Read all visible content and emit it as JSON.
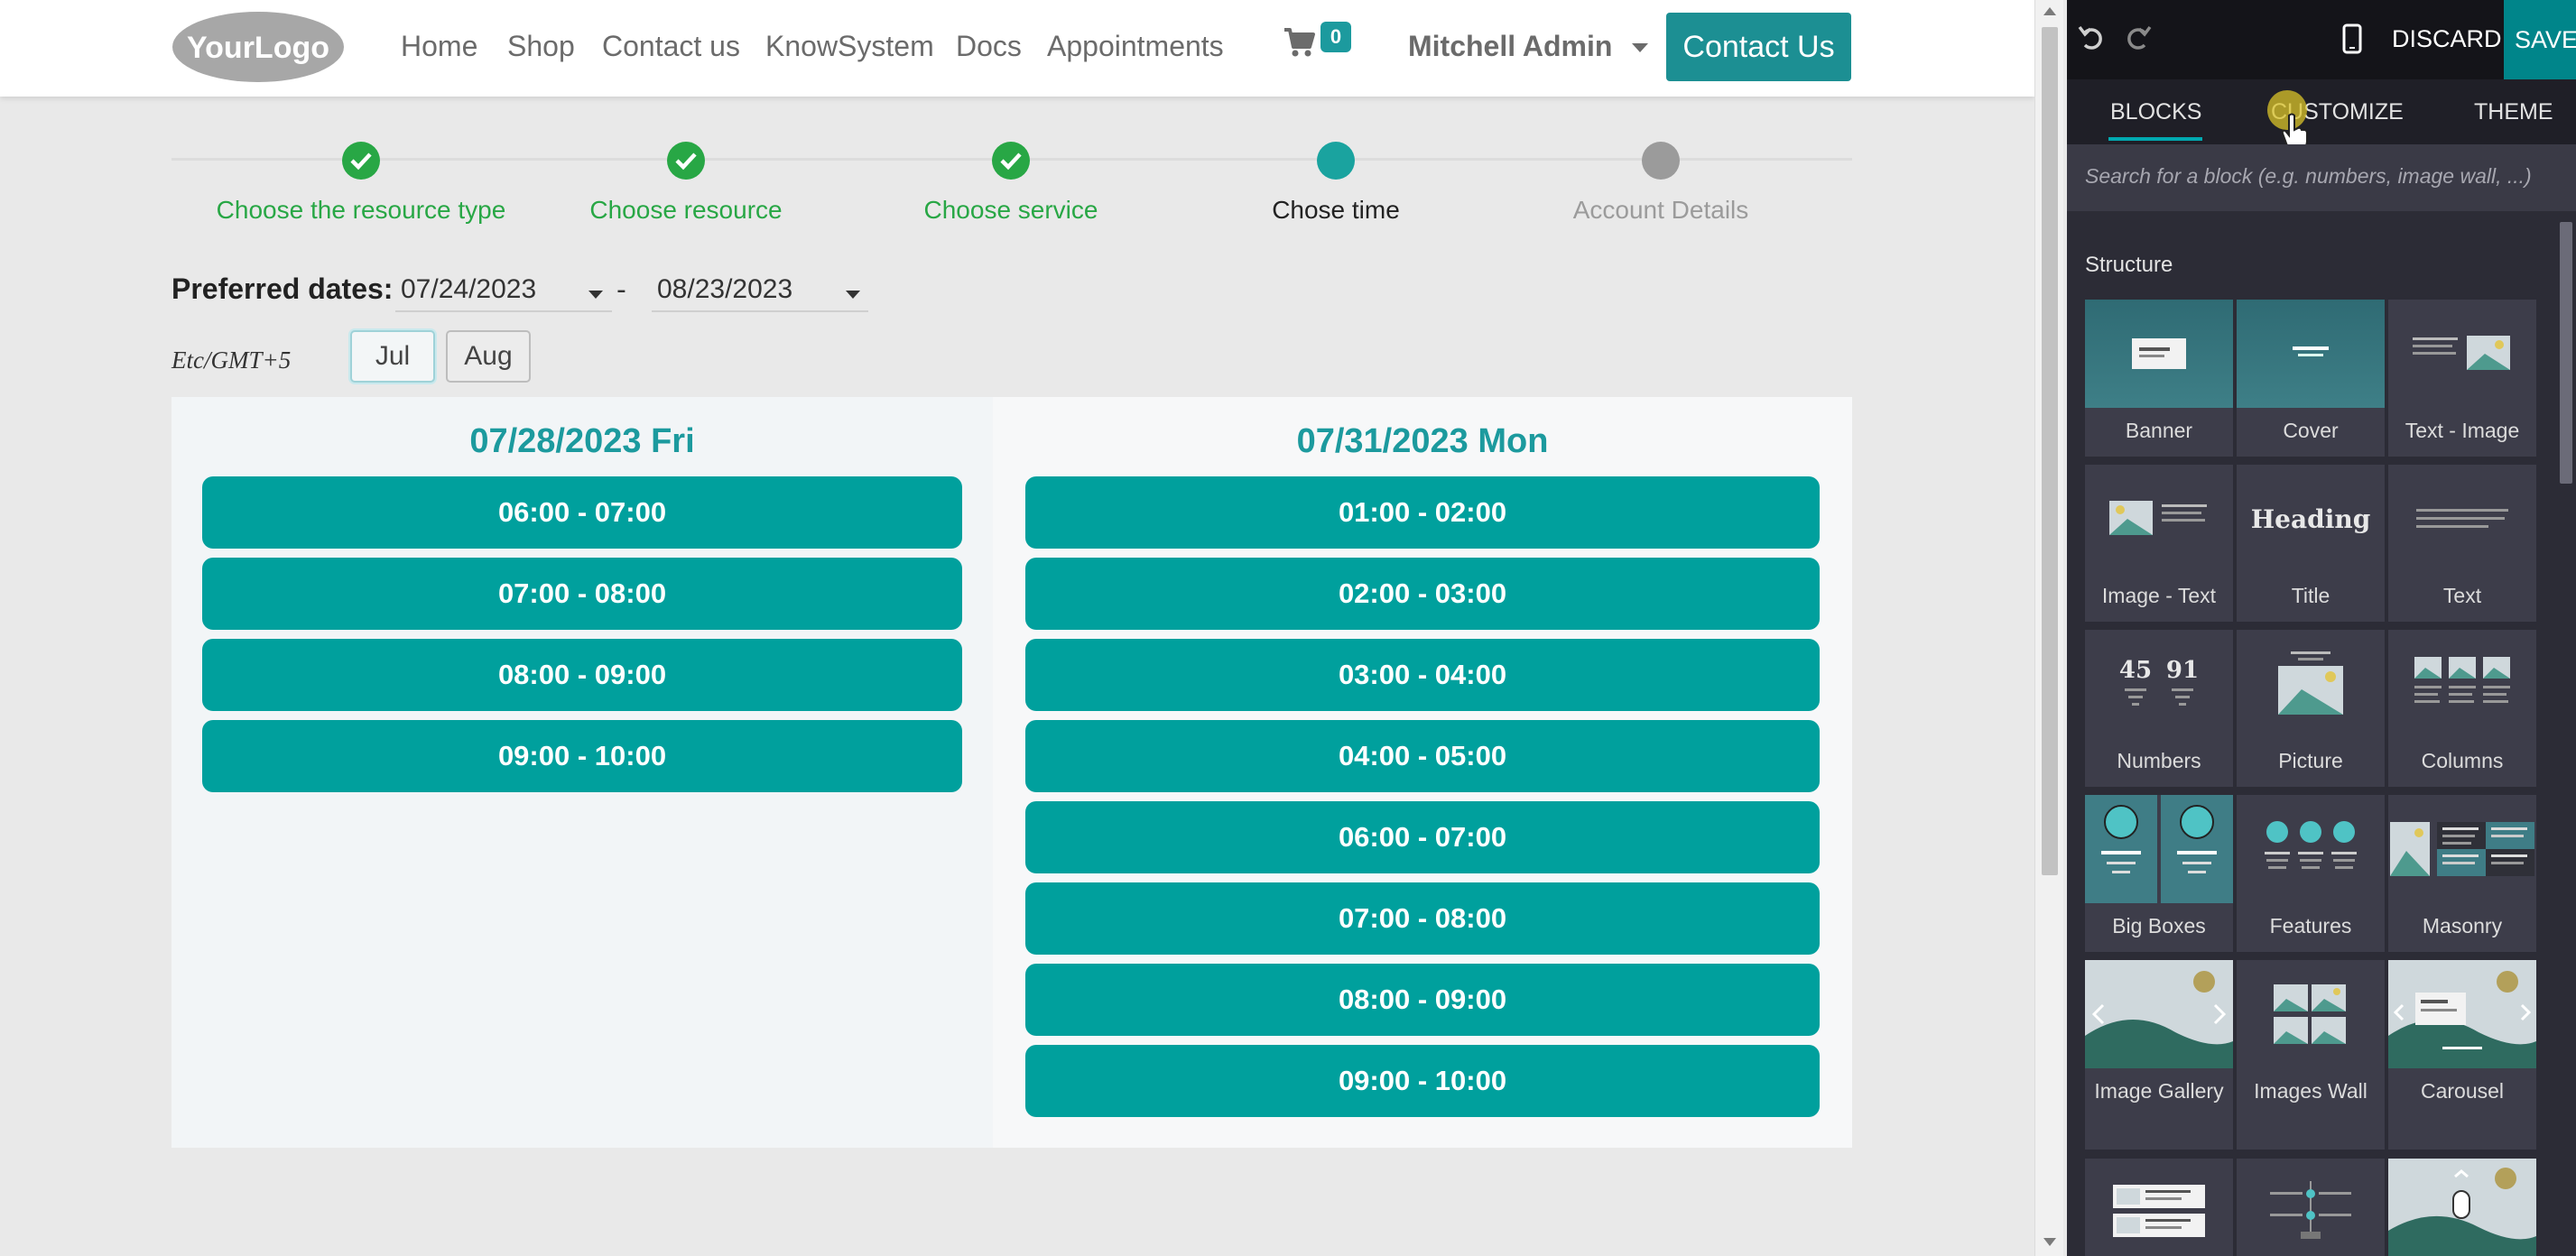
{
  "navbar": {
    "logo_text": "YourLogo",
    "links": [
      "Home",
      "Shop",
      "Contact us",
      "KnowSystem",
      "Docs",
      "Appointments"
    ],
    "cart_count": "0",
    "user": "Mitchell Admin",
    "contact_button": "Contact Us"
  },
  "steps": [
    {
      "label": "Choose the resource type",
      "state": "done"
    },
    {
      "label": "Choose resource",
      "state": "done"
    },
    {
      "label": "Choose service",
      "state": "done"
    },
    {
      "label": "Chose time",
      "state": "current"
    },
    {
      "label": "Account Details",
      "state": "todo"
    }
  ],
  "dates": {
    "label": "Preferred dates:",
    "from": "07/24/2023",
    "separator": "-",
    "to": "08/23/2023",
    "timezone": "Etc/GMT+5",
    "months": [
      "Jul",
      "Aug"
    ],
    "active_month": "Jul"
  },
  "days": [
    {
      "title": "07/28/2023 Fri",
      "slots": [
        "06:00 - 07:00",
        "07:00 - 08:00",
        "08:00 - 09:00",
        "09:00 - 10:00"
      ]
    },
    {
      "title": "07/31/2023 Mon",
      "slots": [
        "01:00 - 02:00",
        "02:00 - 03:00",
        "03:00 - 04:00",
        "04:00 - 05:00",
        "06:00 - 07:00",
        "07:00 - 08:00",
        "08:00 - 09:00",
        "09:00 - 10:00"
      ]
    }
  ],
  "editor": {
    "discard": "DISCARD",
    "save": "SAVE",
    "tabs": [
      "BLOCKS",
      "CUSTOMIZE",
      "THEME"
    ],
    "active_tab": "BLOCKS",
    "search_placeholder": "Search for a block (e.g. numbers, image wall, ...)",
    "section": "Structure",
    "blocks": [
      "Banner",
      "Cover",
      "Text - Image",
      "Image - Text",
      "Title",
      "Text",
      "Numbers",
      "Picture",
      "Columns",
      "Big Boxes",
      "Features",
      "Masonry",
      "Image Gallery",
      "Images Wall",
      "Carousel"
    ],
    "heading_sample": "Heading",
    "numbers_sample": [
      "45",
      "91"
    ]
  },
  "colors": {
    "teal": "#00a09d",
    "done_green": "#28a745",
    "editor_bg": "#2c2c36"
  }
}
